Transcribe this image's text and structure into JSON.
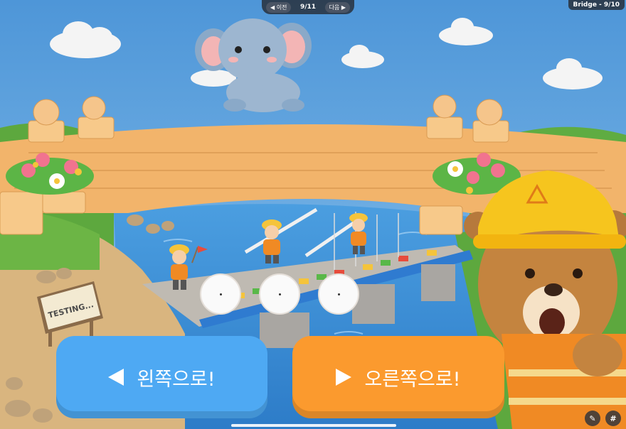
{
  "nav": {
    "prev_label": "◀ 이전",
    "page": "9/11",
    "next_label": "다음 ▶"
  },
  "level_badge": "Bridge - 9/10",
  "sign_text": "TESTING...",
  "buttons": {
    "left_label": "왼쪽으로!",
    "right_label": "오른쪽으로!"
  },
  "dots": [
    "·",
    "·",
    "·"
  ],
  "corner": {
    "hash": "#"
  },
  "colors": {
    "sky": "#5fa3dc",
    "left_button": "#4ea9f3",
    "right_button": "#fb9a2e",
    "brick": "#f2b46b",
    "river": "#3a8fd6",
    "grass": "#6cb545"
  }
}
